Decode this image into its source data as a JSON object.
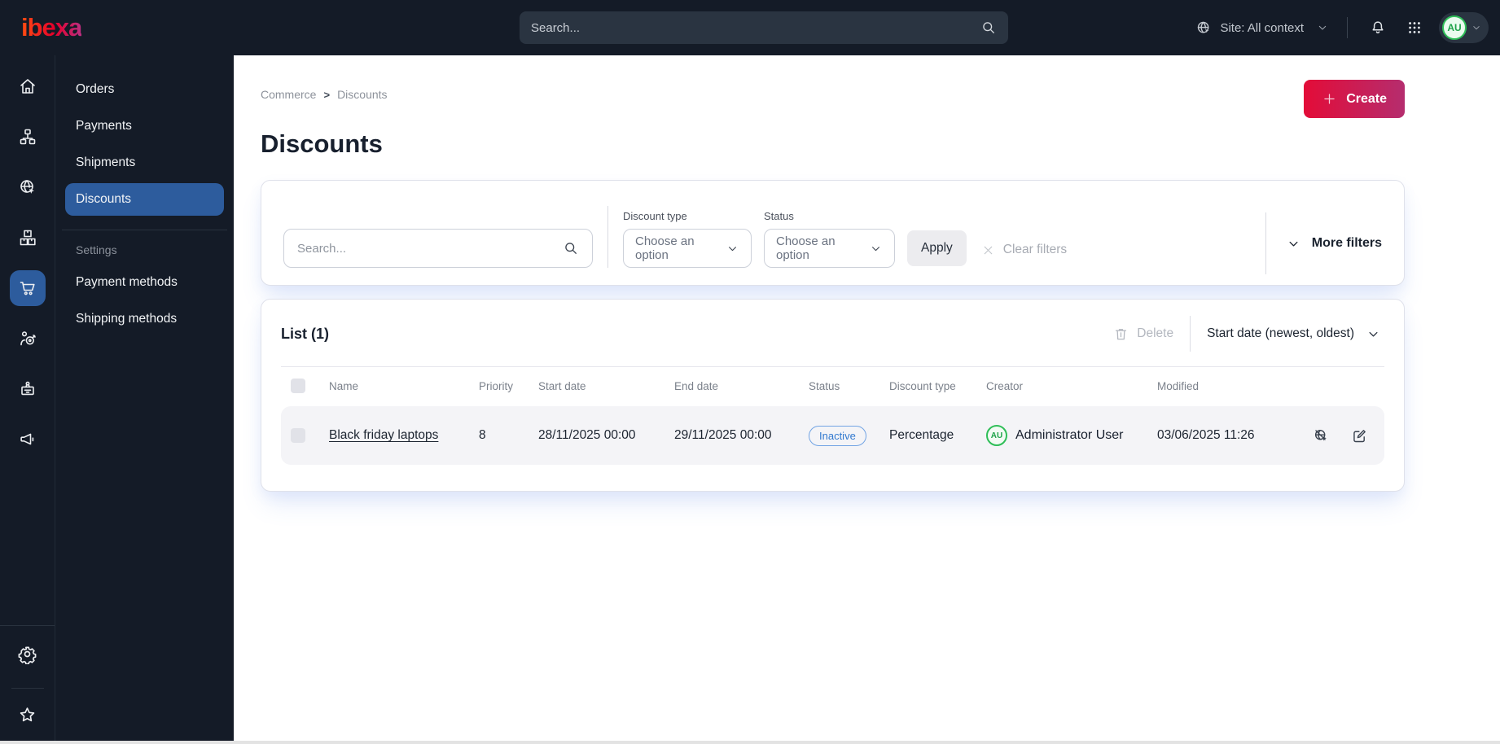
{
  "topbar": {
    "logo": "ibexa",
    "search_placeholder": "Search...",
    "site_context": "Site: All context",
    "avatar_initials": "AU"
  },
  "icon_rail": {
    "items": [
      {
        "icon": "home-icon",
        "active": false
      },
      {
        "icon": "content-tree-icon",
        "active": false
      },
      {
        "icon": "site-globe-icon",
        "active": false
      },
      {
        "icon": "product-boxes-icon",
        "active": false
      },
      {
        "icon": "commerce-cart-icon",
        "active": true
      },
      {
        "icon": "personalization-target-icon",
        "active": false
      },
      {
        "icon": "customer-badge-icon",
        "active": false
      },
      {
        "icon": "marketing-megaphone-icon",
        "active": false
      }
    ],
    "bottom_items": [
      {
        "icon": "settings-gear-icon"
      },
      {
        "icon": "bookmarks-star-icon"
      }
    ]
  },
  "sidebar": {
    "items": [
      {
        "label": "Orders",
        "active": false
      },
      {
        "label": "Payments",
        "active": false
      },
      {
        "label": "Shipments",
        "active": false
      },
      {
        "label": "Discounts",
        "active": true
      }
    ],
    "section_label": "Settings",
    "settings_items": [
      {
        "label": "Payment methods"
      },
      {
        "label": "Shipping methods"
      }
    ]
  },
  "breadcrumb": {
    "items": [
      "Commerce",
      "Discounts"
    ],
    "separator": ">"
  },
  "page": {
    "title": "Discounts",
    "create_label": "Create"
  },
  "filters": {
    "search_placeholder": "Search...",
    "discount_type_label": "Discount type",
    "discount_type_value": "Choose an option",
    "status_label": "Status",
    "status_value": "Choose an option",
    "apply_label": "Apply",
    "clear_label": "Clear filters",
    "more_label": "More filters"
  },
  "list": {
    "title": "List (1)",
    "delete_label": "Delete",
    "sort_label": "Start date (newest, oldest)",
    "columns": {
      "name": "Name",
      "priority": "Priority",
      "start_date": "Start date",
      "end_date": "End date",
      "status": "Status",
      "discount_type": "Discount type",
      "creator": "Creator",
      "modified": "Modified"
    },
    "rows": [
      {
        "name": "Black friday laptops",
        "priority": "8",
        "start_date": "28/11/2025 00:00",
        "end_date": "29/11/2025 00:00",
        "status": "Inactive",
        "discount_type": "Percentage",
        "creator_initials": "AU",
        "creator": "Administrator User",
        "modified": "03/06/2025 11:26"
      }
    ]
  },
  "colors": {
    "topbar_bg": "#141b27",
    "active_nav_blue": "#2d5c9d",
    "brand_gradient_start": "#e30c38",
    "brand_gradient_end": "#b52d6e",
    "status_badge_blue": "#3279cf",
    "avatar_green": "#2fbe58",
    "row_bg": "#f4f4f7"
  }
}
